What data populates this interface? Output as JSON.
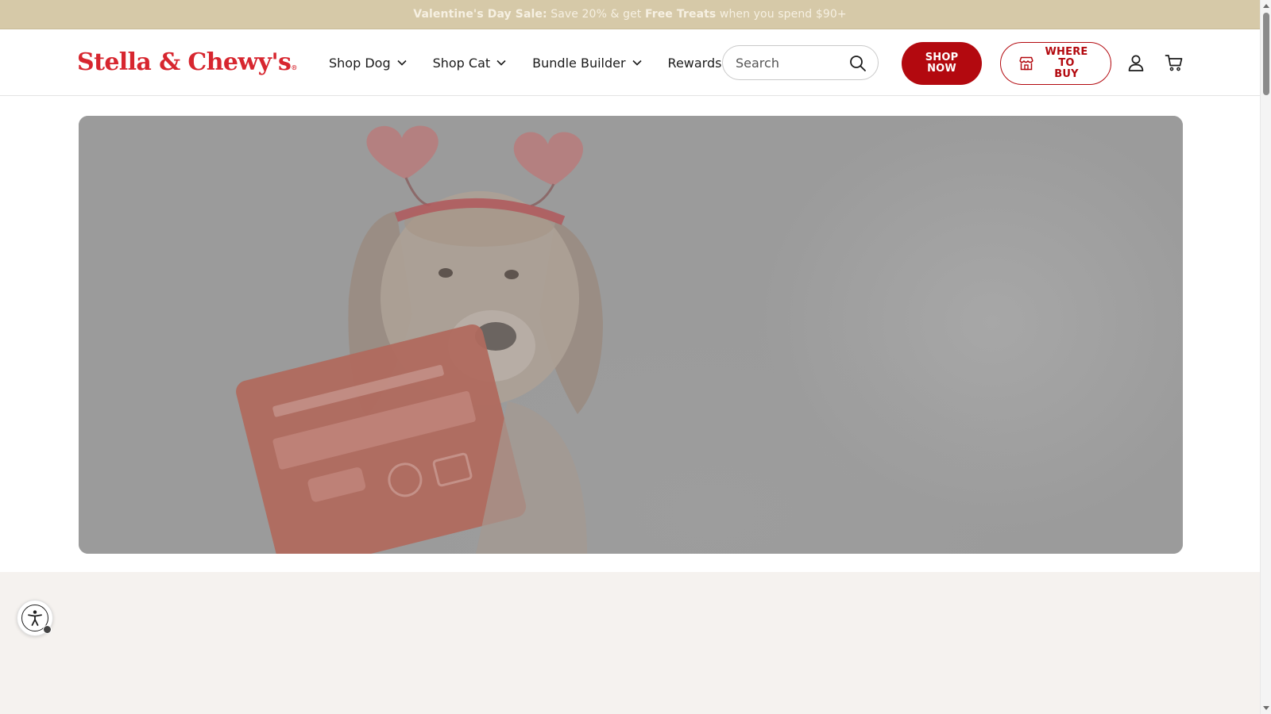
{
  "announcement": {
    "sale_label": "Valentine's Day Sale:",
    "text_1": " Save 20% & get ",
    "highlight": "Free Treats",
    "text_2": " when you spend $90+"
  },
  "header": {
    "logo_text": "Stella & Chewy's",
    "logo_mark": "®",
    "nav": [
      {
        "label": "Shop Dog"
      },
      {
        "label": "Shop Cat"
      },
      {
        "label": "Bundle Builder"
      },
      {
        "label": "Rewards"
      }
    ],
    "search": {
      "placeholder": "Search"
    },
    "shop_now_line1": "SHOP",
    "shop_now_line2": "NOW",
    "where_line1": "WHERE",
    "where_line2": "TO BUY"
  },
  "colors": {
    "brand_red": "#d7262f",
    "button_red": "#b3090f",
    "announcement_bg": "#d6c9a8",
    "band_bg": "#f5f2ef"
  },
  "icons": {
    "search": "search-icon",
    "account": "user-icon",
    "cart": "cart-icon",
    "store": "store-icon",
    "accessibility": "accessibility-icon",
    "chevron": "chevron-down-icon"
  }
}
